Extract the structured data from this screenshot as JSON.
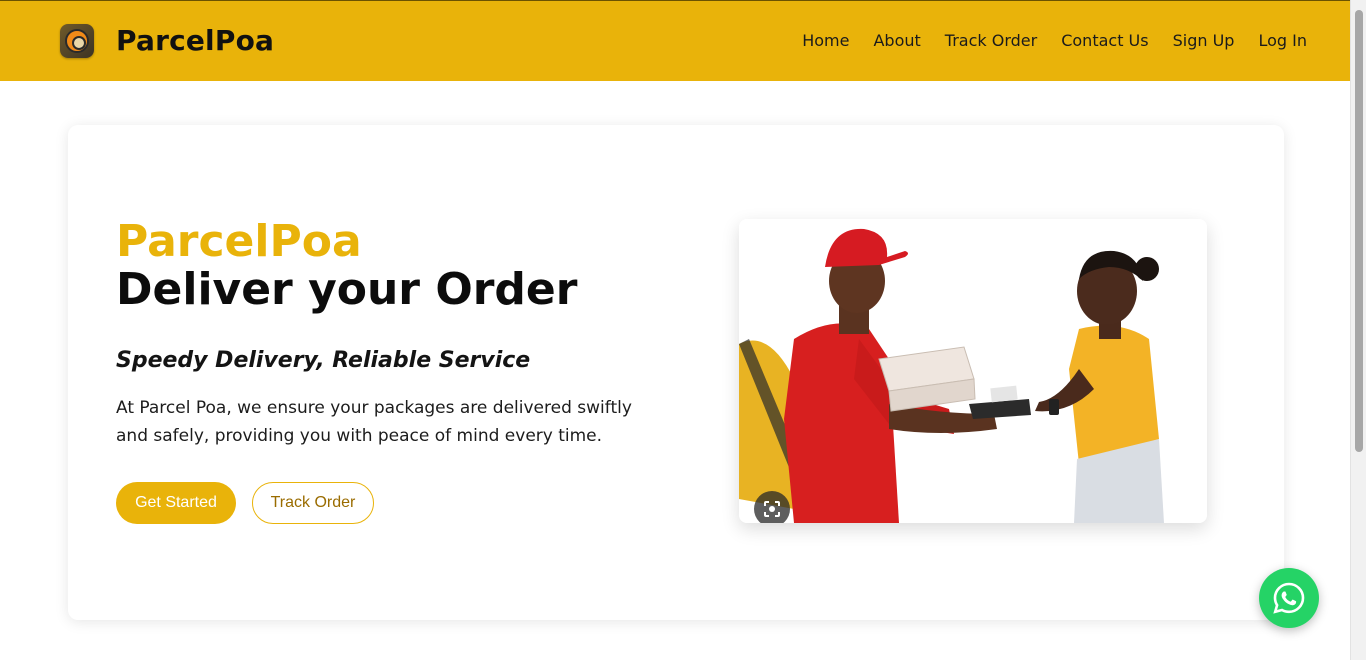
{
  "header": {
    "brand_name": "ParcelPoa",
    "logo_icon": "parcelpoa-logo-icon",
    "nav": [
      {
        "label": "Home"
      },
      {
        "label": "About"
      },
      {
        "label": "Track Order"
      },
      {
        "label": "Contact Us"
      },
      {
        "label": "Sign Up"
      },
      {
        "label": "Log In"
      }
    ]
  },
  "hero": {
    "brand": "ParcelPoa",
    "headline": "Deliver your Order",
    "tagline": "Speedy Delivery, Reliable Service",
    "description": "At Parcel Poa, we ensure your packages are delivered swiftly and safely, providing you with peace of mind every time.",
    "primary_button": "Get Started",
    "secondary_button": "Track Order",
    "image_icon": "lens-icon"
  },
  "floating": {
    "whatsapp_icon": "whatsapp-icon"
  },
  "colors": {
    "accent": "#e9b30a",
    "whatsapp": "#25d366",
    "text": "#111111"
  }
}
